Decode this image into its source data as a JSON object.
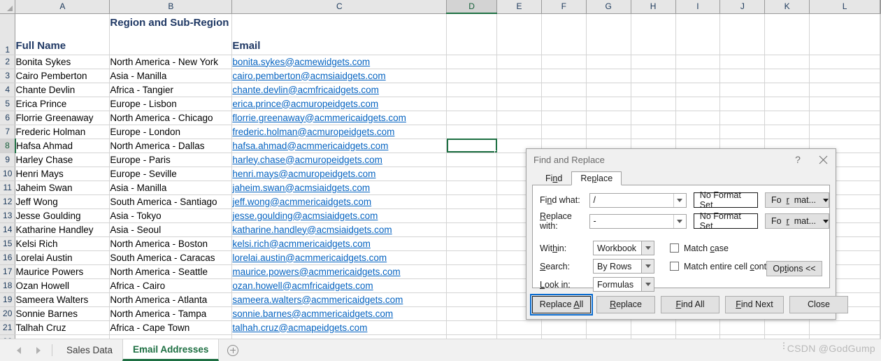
{
  "spreadsheet": {
    "columns": [
      "A",
      "B",
      "C",
      "D",
      "E",
      "F",
      "G",
      "H",
      "I",
      "J",
      "K",
      "L"
    ],
    "selected_column": "D",
    "selected_row": "8",
    "selected_cell": "D8",
    "rows": [
      "1",
      "2",
      "3",
      "4",
      "5",
      "6",
      "7",
      "8",
      "9",
      "10",
      "11",
      "12",
      "13",
      "14",
      "15",
      "16",
      "17",
      "18",
      "19",
      "20",
      "21",
      "22"
    ],
    "headers": {
      "a": "Full Name",
      "b": "Region and Sub-Region",
      "c": "Email"
    },
    "data": [
      {
        "row": "2",
        "name": "Bonita Sykes",
        "region": "North America - New York",
        "email": "bonita.sykes@acmewidgets.com"
      },
      {
        "row": "3",
        "name": "Cairo Pemberton",
        "region": "Asia - Manilla",
        "email": "cairo.pemberton@acmsiaidgets.com"
      },
      {
        "row": "4",
        "name": "Chante Devlin",
        "region": "Africa - Tangier",
        "email": "chante.devlin@acmfricaidgets.com"
      },
      {
        "row": "5",
        "name": "Erica Prince",
        "region": "Europe - Lisbon",
        "email": "erica.prince@acmuropeidgets.com"
      },
      {
        "row": "6",
        "name": "Florrie Greenaway",
        "region": "North America - Chicago",
        "email": "florrie.greenaway@acmmericaidgets.com"
      },
      {
        "row": "7",
        "name": "Frederic Holman",
        "region": "Europe - London",
        "email": "frederic.holman@acmuropeidgets.com"
      },
      {
        "row": "8",
        "name": "Hafsa Ahmad",
        "region": "North America - Dallas",
        "email": "hafsa.ahmad@acmmericaidgets.com"
      },
      {
        "row": "9",
        "name": "Harley Chase",
        "region": "Europe - Paris",
        "email": "harley.chase@acmuropeidgets.com"
      },
      {
        "row": "10",
        "name": "Henri Mays",
        "region": "Europe - Seville",
        "email": "henri.mays@acmuropeidgets.com"
      },
      {
        "row": "11",
        "name": "Jaheim Swan",
        "region": "Asia - Manilla",
        "email": "jaheim.swan@acmsiaidgets.com"
      },
      {
        "row": "12",
        "name": "Jeff Wong",
        "region": "South America - Santiago",
        "email": "jeff.wong@acmmericaidgets.com"
      },
      {
        "row": "13",
        "name": "Jesse Goulding",
        "region": "Asia - Tokyo",
        "email": "jesse.goulding@acmsiaidgets.com"
      },
      {
        "row": "14",
        "name": "Katharine Handley",
        "region": "Asia - Seoul",
        "email": "katharine.handley@acmsiaidgets.com"
      },
      {
        "row": "15",
        "name": "Kelsi Rich",
        "region": "North America - Boston",
        "email": "kelsi.rich@acmmericaidgets.com"
      },
      {
        "row": "16",
        "name": "Lorelai Austin",
        "region": "South America - Caracas",
        "email": "lorelai.austin@acmmericaidgets.com"
      },
      {
        "row": "17",
        "name": "Maurice Powers",
        "region": "North America - Seattle",
        "email": "maurice.powers@acmmericaidgets.com"
      },
      {
        "row": "18",
        "name": "Ozan Howell",
        "region": "Africa - Cairo",
        "email": "ozan.howell@acmfricaidgets.com"
      },
      {
        "row": "19",
        "name": "Sameera Walters",
        "region": "North America - Atlanta",
        "email": "sameera.walters@acmmericaidgets.com"
      },
      {
        "row": "20",
        "name": "Sonnie Barnes",
        "region": "North America - Tampa",
        "email": "sonnie.barnes@acmmericaidgets.com"
      },
      {
        "row": "21",
        "name": "Talhah Cruz",
        "region": "Africa - Cape Town",
        "email": "talhah.cruz@acmapeidgets.com"
      }
    ]
  },
  "sheet_tabs": {
    "tabs": [
      {
        "label": "Sales Data",
        "active": false
      },
      {
        "label": "Email Addresses",
        "active": true
      }
    ],
    "add_sheet_label": "",
    "prev_icon": "triangle-left-icon",
    "next_icon": "triangle-right-icon"
  },
  "watermark": "CSDN @GodGump",
  "dialog": {
    "title": "Find and Replace",
    "help_label": "?",
    "close_label": "✕",
    "tabs": [
      {
        "label": "Find",
        "active": false
      },
      {
        "label": "Replace",
        "active": true
      }
    ],
    "fields": {
      "find_what_label": "Find what:",
      "find_what_value": "/",
      "replace_with_label": "Replace with:",
      "replace_with_value": "-",
      "no_format_set_1": "No Format Set",
      "no_format_set_2": "No Format Set",
      "format_button_1": "Format...",
      "format_button_2": "Format...",
      "within_label": "Within:",
      "within_value": "Workbook",
      "search_label": "Search:",
      "search_value": "By Rows",
      "look_in_label": "Look in:",
      "look_in_value": "Formulas",
      "match_case_label": "Match case",
      "match_case_checked": false,
      "match_entire_label": "Match entire cell contents",
      "match_entire_checked": false,
      "options_button": "Options <<"
    },
    "buttons": {
      "replace_all": "Replace All",
      "replace": "Replace",
      "find_all": "Find All",
      "find_next": "Find Next",
      "close": "Close"
    }
  },
  "colors": {
    "accent_green": "#1d6f42",
    "header_text_blue": "#1f3864",
    "link_blue": "#0563c1",
    "focus_blue": "#0b6ccf"
  }
}
